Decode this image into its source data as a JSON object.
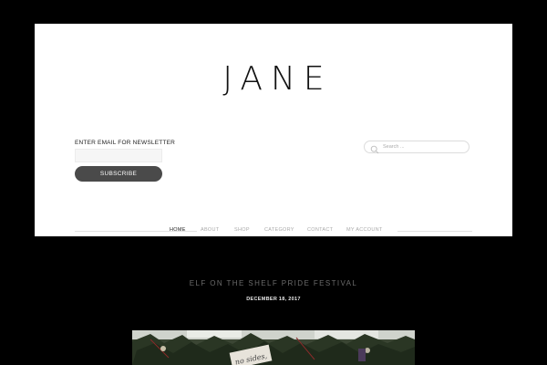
{
  "site": {
    "title": "JANE"
  },
  "newsletter": {
    "label": "ENTER EMAIL FOR NEWSLETTER",
    "email_value": "",
    "email_placeholder": "",
    "subscribe_label": "SUBSCRIBE"
  },
  "search": {
    "placeholder": "Search ...",
    "value": "",
    "icon": "search-icon"
  },
  "nav": {
    "items": [
      {
        "label": "HOME",
        "active": true
      },
      {
        "label": "ABOUT",
        "active": false
      },
      {
        "label": "SHOP",
        "active": false
      },
      {
        "label": "CATEGORY",
        "active": false
      },
      {
        "label": "CONTACT",
        "active": false
      },
      {
        "label": "MY ACCOUNT",
        "active": false
      }
    ]
  },
  "post": {
    "title": "ELF ON THE SHELF PRIDE FESTIVAL",
    "date": "DECEMBER 18, 2017",
    "image_caption": "no sides,"
  },
  "colors": {
    "page_background": "#000000",
    "header_background": "#ffffff",
    "button_background": "#4a4a4a",
    "nav_active": "#222222",
    "nav_inactive": "#aaaaaa",
    "post_title": "#6b6b6b"
  }
}
